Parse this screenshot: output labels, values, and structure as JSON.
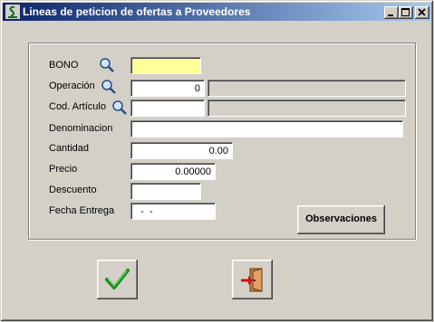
{
  "window": {
    "title": "Lineas de peticion de ofertas a Proveedores",
    "icon": "app-s-icon",
    "controls": {
      "minimize": "minimize-icon",
      "maximize": "maximize-icon",
      "close": "close-icon"
    }
  },
  "form": {
    "bono": {
      "label": "BONO",
      "value": "",
      "background": "#ffff99"
    },
    "operacion": {
      "label": "Operación",
      "value": "0",
      "description": ""
    },
    "cod_articulo": {
      "label": "Cod. Artículo",
      "value": "",
      "description": ""
    },
    "denominacion": {
      "label": "Denominacion",
      "value": ""
    },
    "cantidad": {
      "label": "Cantidad",
      "value": "0.00"
    },
    "precio": {
      "label": "Precio",
      "value": "0.00000"
    },
    "descuento": {
      "label": "Descuento",
      "value": ""
    },
    "fecha_entrega": {
      "label": "Fecha Entrega",
      "value": "  -  -"
    },
    "lookup_icon": "magnifier-icon"
  },
  "buttons": {
    "observaciones": "Observaciones",
    "accept_icon": "checkmark-icon",
    "exit_icon": "exit-door-icon"
  }
}
